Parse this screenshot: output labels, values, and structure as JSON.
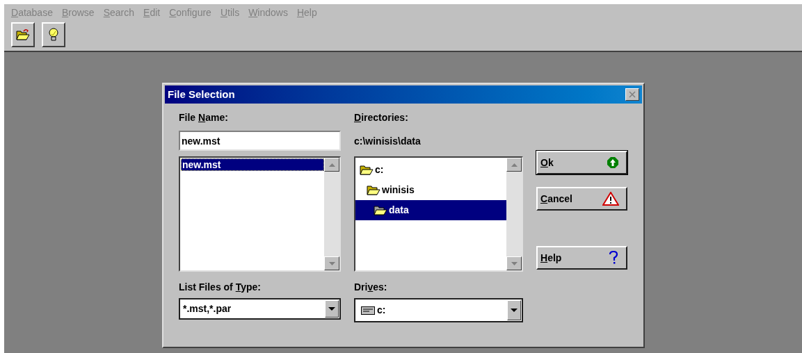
{
  "menu": [
    {
      "label": {
        "key": "D",
        "post": "atabase"
      }
    },
    {
      "label": {
        "key": "B",
        "post": "rowse"
      }
    },
    {
      "label": {
        "key": "S",
        "post": "earch"
      }
    },
    {
      "label": {
        "key": "E",
        "post": "dit"
      }
    },
    {
      "label": {
        "key": "C",
        "post": "onfigure"
      }
    },
    {
      "label": {
        "key": "U",
        "post": "tils"
      }
    },
    {
      "label": {
        "key": "W",
        "post": "indows"
      }
    },
    {
      "label": {
        "key": "H",
        "post": "elp"
      }
    }
  ],
  "toolbar": [
    {
      "kind": "open"
    },
    {
      "kind": "idea"
    }
  ],
  "dialog": {
    "title": "File Selection",
    "file_name": {
      "label": {
        "pre": "File ",
        "key": "N",
        "post": "ame:"
      },
      "value": "new.mst",
      "files": [
        {
          "name": "new.mst",
          "selected": true
        }
      ]
    },
    "directories": {
      "label": {
        "key": "D",
        "post": "irectories:"
      },
      "path": "c:\\winisis\\data",
      "tree": [
        {
          "name": "c:",
          "selected": false,
          "children": [
            {
              "name": "winisis",
              "selected": false,
              "children": [
                {
                  "name": "data",
                  "selected": true
                }
              ]
            }
          ]
        }
      ]
    },
    "file_type": {
      "label": {
        "pre": "List Files of ",
        "key": "T",
        "post": "ype:"
      },
      "value": "*.mst,*.par"
    },
    "drives": {
      "label": {
        "pre": "Dri",
        "key": "v",
        "post": "es:"
      },
      "value": "c:"
    },
    "buttons": [
      {
        "label": {
          "key": "O",
          "post": "k"
        },
        "kind": "ok"
      },
      {
        "label": {
          "key": "C",
          "post": "ancel"
        },
        "kind": "cancel"
      },
      {
        "label": {
          "key": "H",
          "post": "elp"
        },
        "kind": "help"
      }
    ]
  }
}
